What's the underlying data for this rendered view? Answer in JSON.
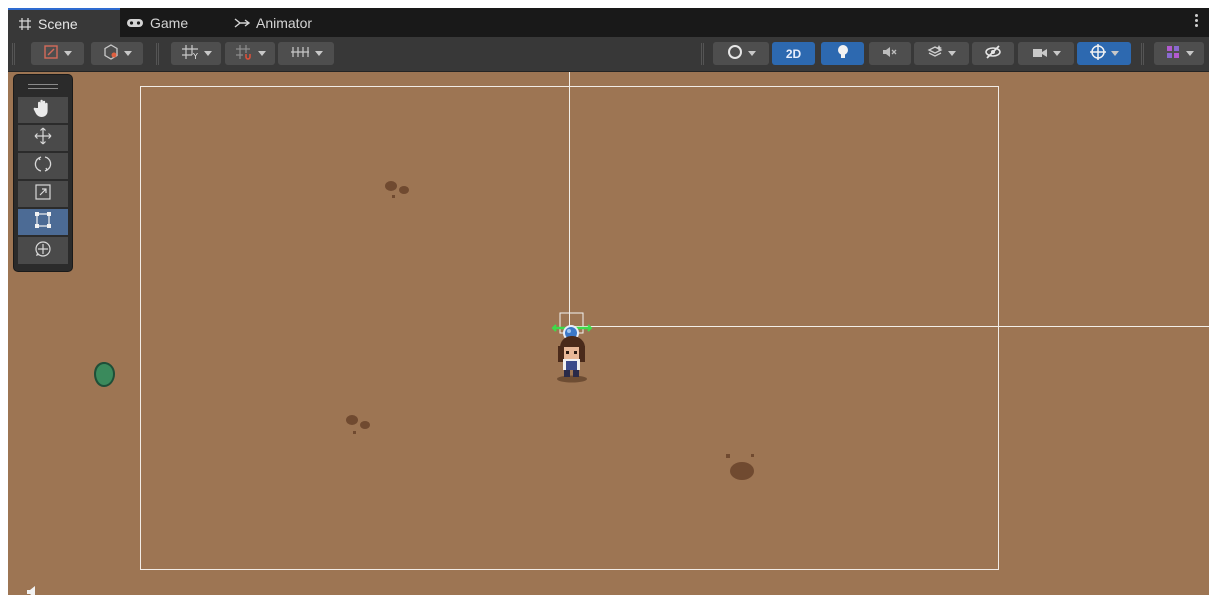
{
  "tabs": [
    {
      "label": "Scene",
      "icon": "grid-icon",
      "active": true
    },
    {
      "label": "Game",
      "icon": "gamepad-icon",
      "active": false
    },
    {
      "label": "Animator",
      "icon": "animator-icon",
      "active": false
    }
  ],
  "toolbar": {
    "toggle_2d_label": "2D"
  },
  "tools": [
    "hand-icon",
    "move-icon",
    "rotate-icon",
    "scale-icon",
    "rect-icon",
    "transform-icon"
  ],
  "selected_tool": "rect-icon",
  "colors": {
    "accent": "#2d69b0",
    "scene_bg": "#9d7553",
    "dirt": "#704a30",
    "bush": "#3a8a5c",
    "pivot": "#3b78c8",
    "gizmo_green": "#3ddc4a"
  }
}
